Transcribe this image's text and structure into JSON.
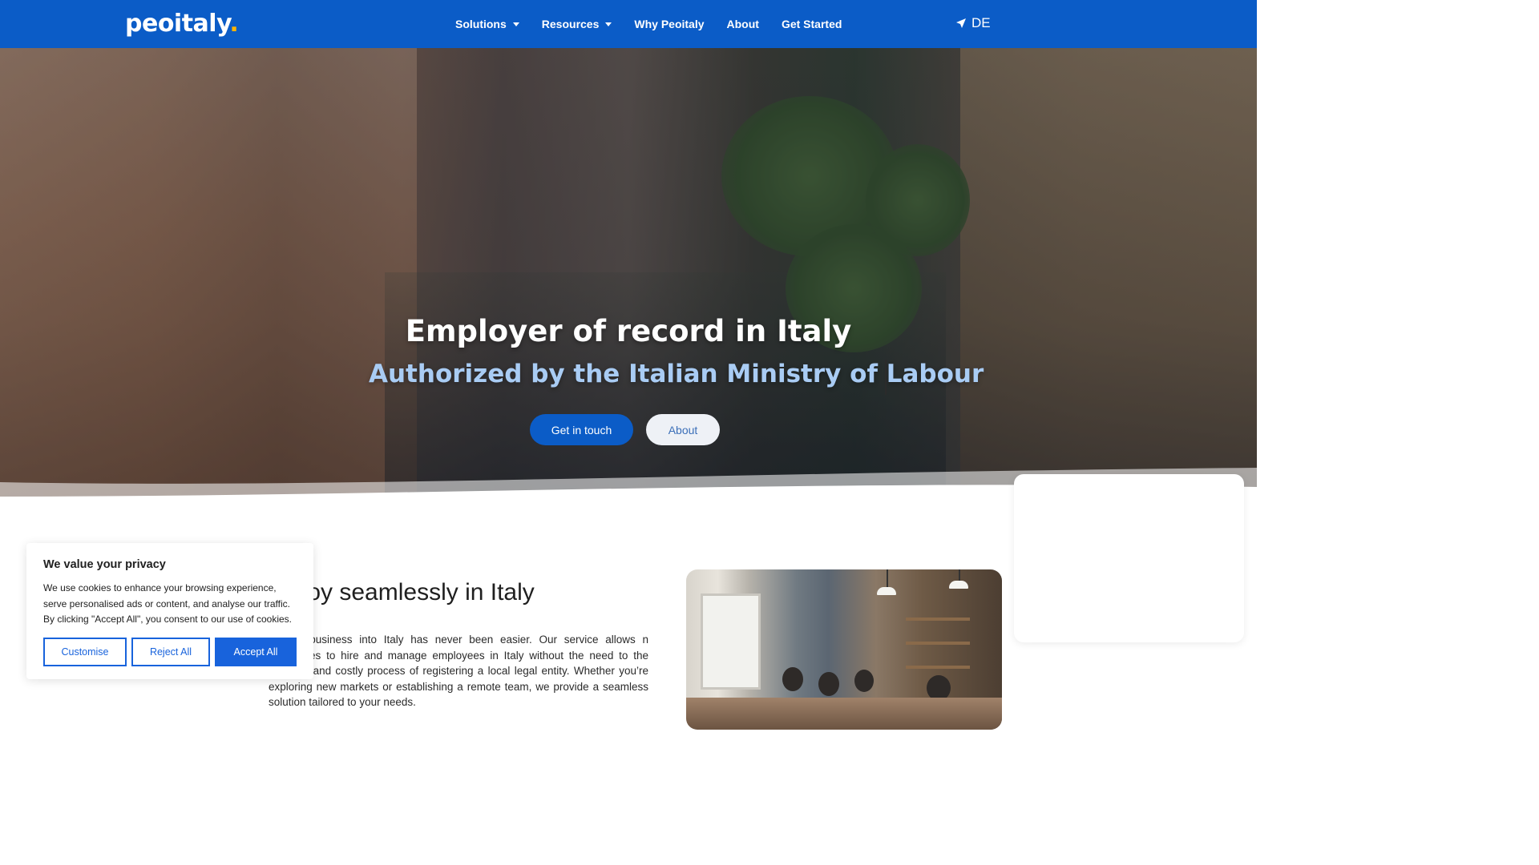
{
  "nav": {
    "logo": "peoitaly",
    "logo_dot": ".",
    "items": [
      {
        "label": "Solutions",
        "dropdown": true
      },
      {
        "label": "Resources",
        "dropdown": true
      },
      {
        "label": "Why Peoitaly",
        "dropdown": false
      },
      {
        "label": "About",
        "dropdown": false
      },
      {
        "label": "Get Started",
        "dropdown": false
      }
    ],
    "language": "DE"
  },
  "hero": {
    "title": "Employer of record in Italy",
    "subtitle": "Authorized by the Italian Ministry of Labour",
    "primary_button": "Get in touch",
    "secondary_button": "About"
  },
  "section": {
    "title": "ploy seamlessly in Italy",
    "body": "g your business into Italy has never been easier. Our service allows n companies to hire and manage employees in Italy without the need to the complex and costly process of registering a local legal entity. Whether you’re exploring new markets or establishing a remote team, we provide a seamless solution tailored to your needs."
  },
  "cookie": {
    "title": "We value your privacy",
    "text": "We use cookies to enhance your browsing experience, serve personalised ads or content, and analyse our traffic. By clicking \"Accept All\", you consent to our use of cookies.",
    "customise": "Customise",
    "reject": "Reject All",
    "accept": "Accept All"
  },
  "colors": {
    "brand_blue": "#0b5cc7",
    "subtitle_blue": "#a9ccf4",
    "cookie_blue": "#1863dc"
  }
}
